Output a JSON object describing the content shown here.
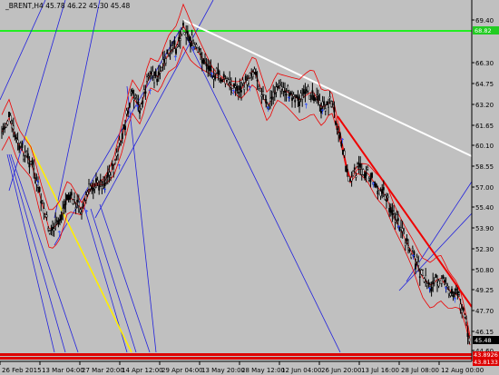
{
  "window": {
    "title": "_BRENT,H4  45.78 46.22 45.30 45.48"
  },
  "price_axis": {
    "ticks": [
      "69.40",
      "66.30",
      "64.75",
      "63.20",
      "61.65",
      "60.10",
      "58.55",
      "57.00",
      "55.40",
      "53.90",
      "52.30",
      "50.80",
      "49.25",
      "47.70",
      "46.15",
      "44.60"
    ]
  },
  "price_tags": [
    {
      "label": "68.82",
      "color": "#22cc22"
    },
    {
      "label": "45.48",
      "color": "#000000"
    },
    {
      "label": "43.8926",
      "color": "#dd0000"
    },
    {
      "label": "43.8133",
      "color": "#dd0000"
    }
  ],
  "time_axis": {
    "ticks": [
      "26 Feb 2015",
      "13 Mar 04:00",
      "27 Mar 20:00",
      "14 Apr 12:00",
      "29 Apr 04:00",
      "13 May 20:00",
      "28 May 12:00",
      "12 Jun 04:00",
      "26 Jun 20:00",
      "13 Jul 16:00",
      "28 Jul 08:00",
      "12 Aug 00:00"
    ]
  },
  "fractal_marker": "↑",
  "colors": {
    "background": "#c0c0c0",
    "candles": "#000000",
    "bands": "#ee0000",
    "green_level": "#22ee22",
    "trendline_white": "#ffffff",
    "trendline_red": "#ee0000",
    "trendline_yellow": "#ffee00",
    "fan_lines": "#2222dd",
    "fractals": "#2244ff"
  },
  "icons": [
    "arrow-up-fractal-icon"
  ]
}
